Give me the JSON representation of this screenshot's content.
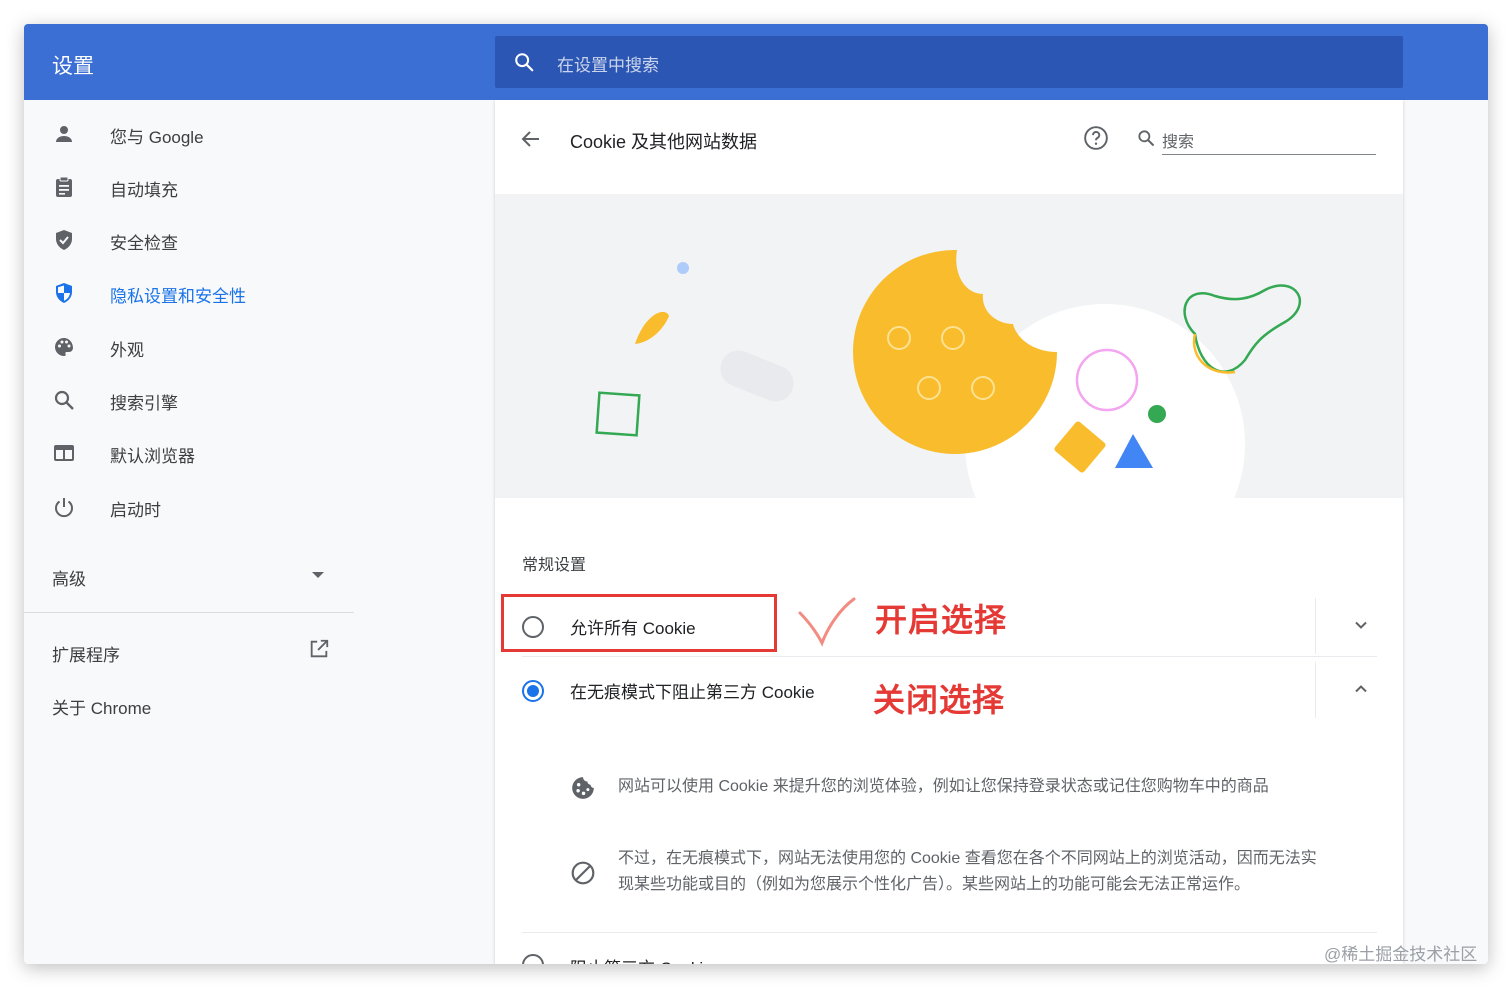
{
  "header": {
    "title": "设置",
    "search_placeholder": "在设置中搜索"
  },
  "sidebar": {
    "items": [
      {
        "label": "您与 Google",
        "icon": "person-icon"
      },
      {
        "label": "自动填充",
        "icon": "clipboard-icon"
      },
      {
        "label": "安全检查",
        "icon": "shield-check-icon"
      },
      {
        "label": "隐私设置和安全性",
        "icon": "privacy-shield-icon",
        "active": true
      },
      {
        "label": "外观",
        "icon": "palette-icon"
      },
      {
        "label": "搜索引擎",
        "icon": "search-icon"
      },
      {
        "label": "默认浏览器",
        "icon": "browser-icon"
      },
      {
        "label": "启动时",
        "icon": "power-icon"
      }
    ],
    "advanced": "高级",
    "extensions": "扩展程序",
    "about": "关于 Chrome"
  },
  "page": {
    "title": "Cookie 及其他网站数据",
    "search_placeholder": "搜索",
    "section_title": "常规设置",
    "options": [
      {
        "label": "允许所有 Cookie",
        "selected": false,
        "expanded": false
      },
      {
        "label": "在无痕模式下阻止第三方 Cookie",
        "selected": true,
        "expanded": true
      },
      {
        "label": "阻止第三方 Cookie",
        "selected": false,
        "expanded": false
      }
    ],
    "info": [
      {
        "icon": "cookie-icon",
        "text": "网站可以使用 Cookie 来提升您的浏览体验，例如让您保持登录状态或记住您购物车中的商品"
      },
      {
        "icon": "block-icon",
        "text_line1": "不过，在无痕模式下，网站无法使用您的 Cookie 查看您在各个不同网站上的浏览活动，因而无法实",
        "text_line2": "现某些功能或目的（例如为您展示个性化广告）。某些网站上的功能可能会无法正常运作。"
      }
    ]
  },
  "annotations": {
    "open": "开启选择",
    "close": "关闭选择"
  },
  "watermark": "@稀土掘金技术社区",
  "colors": {
    "header": "#3b6fd4",
    "accent": "#1a73e8",
    "annotation": "#e53935",
    "cookie": "#f9bc2c"
  }
}
